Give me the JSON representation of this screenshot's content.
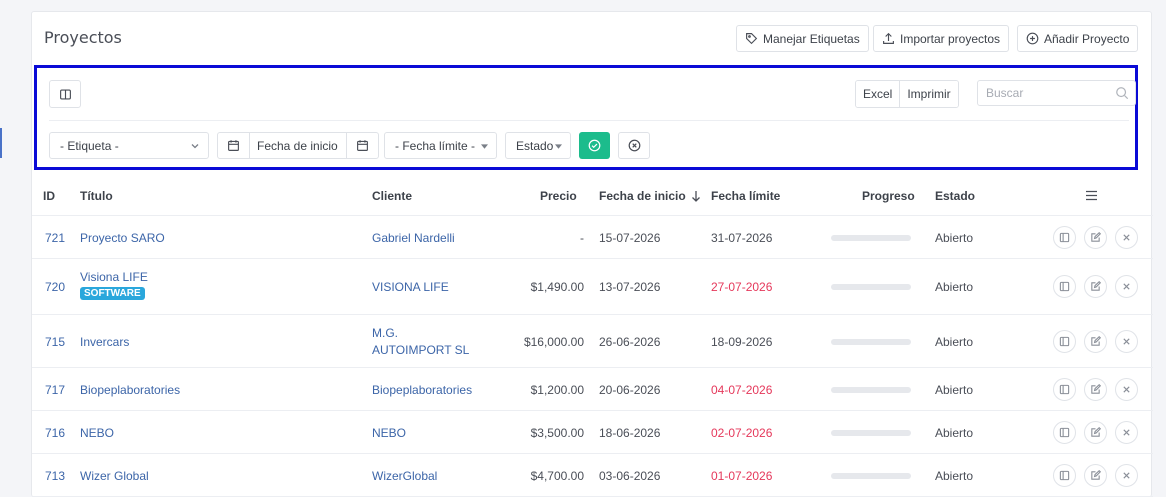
{
  "header": {
    "title": "Proyectos",
    "buttons": {
      "labels": "Manejar Etiquetas",
      "import": "Importar proyectos",
      "add": "Añadir Proyecto"
    }
  },
  "toolbar": {
    "excel": "Excel",
    "print": "Imprimir",
    "search_placeholder": "Buscar"
  },
  "filters": {
    "label": "- Etiqueta -",
    "start_date": "Fecha de inicio",
    "deadline": "- Fecha límite -",
    "status": "Estado"
  },
  "table": {
    "columns": {
      "id": "ID",
      "title": "Título",
      "client": "Cliente",
      "price": "Precio",
      "start": "Fecha de inicio",
      "deadline": "Fecha límite",
      "progress": "Progreso",
      "status": "Estado"
    },
    "rows": [
      {
        "id": "721",
        "title": "Proyecto SARO",
        "badge": "",
        "client": "Gabriel Nardelli",
        "client2": "",
        "price": "-",
        "start": "15-07-2026",
        "deadline": "31-07-2026",
        "late": false,
        "progress": 0,
        "status": "Abierto"
      },
      {
        "id": "720",
        "title": "Visiona LIFE",
        "badge": "SOFTWARE",
        "client": "VISIONA LIFE",
        "client2": "",
        "price": "$1,490.00",
        "start": "13-07-2026",
        "deadline": "27-07-2026",
        "late": true,
        "progress": 0,
        "status": "Abierto"
      },
      {
        "id": "715",
        "title": "Invercars",
        "badge": "",
        "client": "M.G.",
        "client2": "AUTOIMPORT SL",
        "price": "$16,000.00",
        "start": "26-06-2026",
        "deadline": "18-09-2026",
        "late": false,
        "progress": 0,
        "status": "Abierto"
      },
      {
        "id": "717",
        "title": "Biopeplaboratories",
        "badge": "",
        "client": "Biopeplaboratories",
        "client2": "",
        "price": "$1,200.00",
        "start": "20-06-2026",
        "deadline": "04-07-2026",
        "late": true,
        "progress": 0,
        "status": "Abierto"
      },
      {
        "id": "716",
        "title": "NEBO",
        "badge": "",
        "client": "NEBO",
        "client2": "",
        "price": "$3,500.00",
        "start": "18-06-2026",
        "deadline": "02-07-2026",
        "late": true,
        "progress": 0,
        "status": "Abierto"
      },
      {
        "id": "713",
        "title": "Wizer Global",
        "badge": "",
        "client": "WizerGlobal",
        "client2": "",
        "price": "$4,700.00",
        "start": "03-06-2026",
        "deadline": "01-07-2026",
        "late": true,
        "progress": 0,
        "status": "Abierto"
      }
    ]
  },
  "colors": {
    "accent_green": "#1cbc8c",
    "link": "#3c65a8",
    "late": "#e5385b",
    "badge": "#2aa7dc",
    "highlight_border": "#0a0ad6"
  },
  "icons": [
    "tag-icon",
    "upload-icon",
    "plus-circle-icon",
    "columns-icon",
    "search-icon",
    "calendar-icon",
    "check-circle-icon",
    "x-circle-icon",
    "menu-icon",
    "sort-down-icon",
    "view-icon",
    "edit-icon",
    "close-icon"
  ]
}
